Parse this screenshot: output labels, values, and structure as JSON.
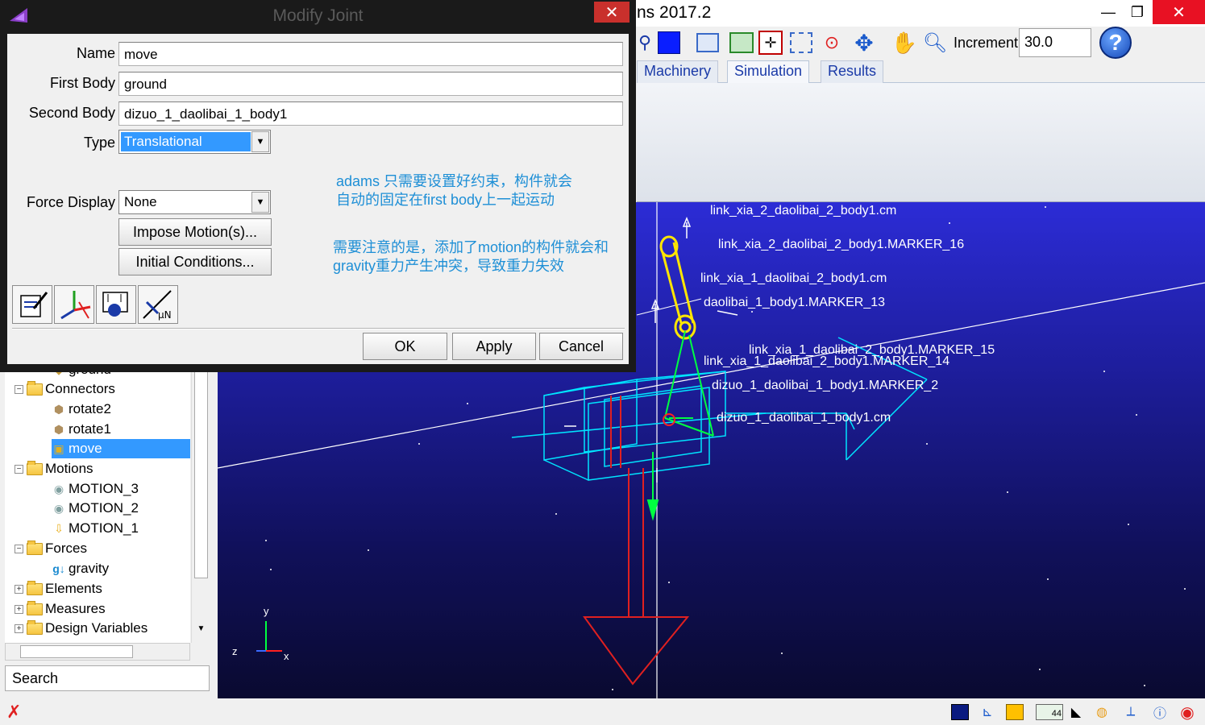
{
  "app": {
    "title_fragment": "ns 2017.2",
    "window_controls": {
      "minimize": "—",
      "maximize": "❐",
      "close": "✕"
    }
  },
  "toolbar": {
    "increment_label": "Increment",
    "increment_value": "30.0",
    "help_glyph": "?"
  },
  "ribbon": {
    "tabs": [
      {
        "label": "Machinery",
        "active": false
      },
      {
        "label": "Simulation",
        "active": true
      },
      {
        "label": "Results",
        "active": false
      }
    ]
  },
  "dialog": {
    "title": "Modify Joint",
    "close_glyph": "✕",
    "fields": {
      "name_label": "Name",
      "name_value": "move",
      "first_body_label": "First Body",
      "first_body_value": "ground",
      "second_body_label": "Second Body",
      "second_body_value": "dizuo_1_daolibai_1_body1",
      "type_label": "Type",
      "type_value": "Translational",
      "force_display_label": "Force Display",
      "force_display_value": "None"
    },
    "buttons": {
      "impose_motion": "Impose Motion(s)...",
      "initial_conditions": "Initial Conditions...",
      "ok": "OK",
      "apply": "Apply",
      "cancel": "Cancel"
    },
    "notes": {
      "note1_line1": "adams 只需要设置好约束，构件就会",
      "note1_line2": "自动的固定在first body上一起运动",
      "note2_line1": "需要注意的是，添加了motion的构件就会和",
      "note2_line2": "gravity重力产生冲突，导致重力失效"
    },
    "tool_icons": [
      "edit-icon",
      "triad-icon",
      "measure-icon",
      "friction-icon"
    ],
    "tool_glyphs": {
      "friction": "μN"
    }
  },
  "tree": {
    "items": [
      {
        "label": "ground",
        "level": 2,
        "type": "body"
      },
      {
        "label": "Connectors",
        "level": 1,
        "type": "folder",
        "expanded": true
      },
      {
        "label": "rotate2",
        "level": 2,
        "type": "joint"
      },
      {
        "label": "rotate1",
        "level": 2,
        "type": "joint"
      },
      {
        "label": "move",
        "level": 2,
        "type": "joint",
        "selected": true
      },
      {
        "label": "Motions",
        "level": 1,
        "type": "folder",
        "expanded": true
      },
      {
        "label": "MOTION_3",
        "level": 2,
        "type": "motion"
      },
      {
        "label": "MOTION_2",
        "level": 2,
        "type": "motion"
      },
      {
        "label": "MOTION_1",
        "level": 2,
        "type": "motion-translational"
      },
      {
        "label": "Forces",
        "level": 1,
        "type": "folder",
        "expanded": true
      },
      {
        "label": "gravity",
        "level": 2,
        "type": "gravity"
      },
      {
        "label": "Elements",
        "level": 1,
        "type": "folder",
        "expanded": false
      },
      {
        "label": "Measures",
        "level": 1,
        "type": "folder",
        "expanded": false
      },
      {
        "label": "Design Variables",
        "level": 1,
        "type": "folder",
        "expanded": false
      }
    ],
    "search_label": "Search",
    "collapse_glyph": "−",
    "expand_glyph": "+"
  },
  "viewport": {
    "labels": [
      "link_xia_2_daolibai_2_body1.cm",
      "link_xia_2_daolibai_2_body1.MARKER_16",
      "link_xia_1_daolibai_2_body1.cm",
      "daolibai_1_body1.MARKER_13",
      "link_xia_1_daolibai_2_body1.MARKER_15",
      "link_xia_1_daolibai_2_body1.MARKER_14",
      "dizuo_1_daolibai_1_body1.MARKER_2",
      "dizuo_1_daolibai_1_body1.cm"
    ],
    "triad": {
      "x": "x",
      "y": "y",
      "z": "z"
    },
    "colors": {
      "background_top": "#2c2cd6",
      "background_bottom": "#0a0a30",
      "wireframe": "#00e5ff",
      "gravity": "#e02020",
      "link": "#ffe600",
      "marker": "#00ff40"
    }
  },
  "statusbar": {
    "badge": "44"
  }
}
